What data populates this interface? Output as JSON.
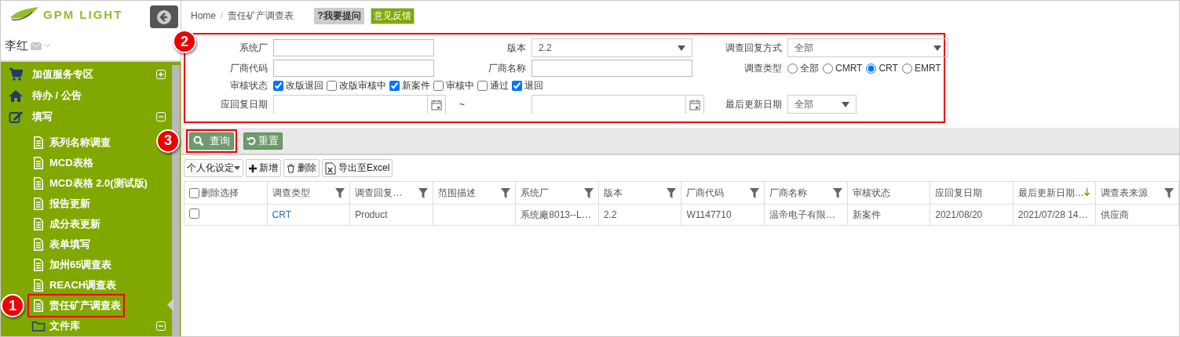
{
  "sidebar": {
    "logo": "GPM LIGHT",
    "user": "李红",
    "items": [
      {
        "label": "加值服务专区",
        "kind": "cart",
        "expanded": false
      },
      {
        "label": "待办 / 公告",
        "kind": "home"
      },
      {
        "label": "填写",
        "kind": "edit",
        "expanded": true,
        "children": [
          {
            "label": "系列名称调查",
            "kind": "doc",
            "highlighted": false
          },
          {
            "label": "MCD表格",
            "kind": "doc",
            "highlighted": false
          },
          {
            "label": "MCD表格 2.0(测试版)",
            "kind": "doc",
            "highlighted": false
          },
          {
            "label": "报告更新",
            "kind": "doc",
            "highlighted": false
          },
          {
            "label": "成分表更新",
            "kind": "doc",
            "highlighted": false
          },
          {
            "label": "表单填写",
            "kind": "doc",
            "highlighted": false
          },
          {
            "label": "加州65调查表",
            "kind": "doc",
            "highlighted": false
          },
          {
            "label": "REACH调查表",
            "kind": "doc",
            "highlighted": false
          },
          {
            "label": "责任矿产调查表",
            "kind": "doc",
            "highlighted": true,
            "callout": "1"
          },
          {
            "label": "文件库",
            "kind": "folder",
            "expanded": true,
            "highlighted": false
          }
        ]
      }
    ]
  },
  "breadcrumb": [
    "Home",
    "责任矿产调查表"
  ],
  "breadcrumb_separator": "/",
  "header_buttons": [
    {
      "label": "?我要提问",
      "kind": "help"
    },
    {
      "label": "意见反馈",
      "kind": "feedback"
    }
  ],
  "filter_panel": {
    "highlighted": true,
    "callout": "2",
    "rows": [
      [
        {
          "label": "系统厂",
          "kind": "text"
        },
        {
          "label": "版本",
          "kind": "select",
          "value": "2.2"
        },
        {
          "label": "调查回复方式",
          "kind": "select",
          "value": "全部"
        }
      ],
      [
        {
          "label": "厂商代码",
          "kind": "text"
        },
        {
          "label": "厂商名称",
          "kind": "text"
        },
        {
          "label": "调查类型",
          "kind": "radios",
          "options": [
            {
              "label": "全部",
              "selected": false
            },
            {
              "label": "CMRT",
              "selected": false
            },
            {
              "label": "CRT",
              "selected": true
            },
            {
              "label": "EMRT",
              "selected": false
            }
          ]
        }
      ],
      [
        {
          "label": "审核状态",
          "kind": "checkboxes",
          "options": [
            {
              "label": "改版退回",
              "checked": true
            },
            {
              "label": "改版审核中",
              "checked": false
            },
            {
              "label": "新案件",
              "checked": true
            },
            {
              "label": "审核中",
              "checked": false
            },
            {
              "label": "通过",
              "checked": false
            },
            {
              "label": "退回",
              "checked": true
            }
          ]
        }
      ],
      [
        {
          "label": "应回复日期",
          "kind": "date"
        },
        {
          "kind": "date_to",
          "separator": "~"
        },
        {
          "label": "最后更新日期",
          "kind": "select_small",
          "value": "全部"
        }
      ]
    ]
  },
  "search_buttons": [
    {
      "label": "查询",
      "kind": "search",
      "highlighted": true,
      "callout": "3"
    },
    {
      "label": "重置",
      "kind": "reset",
      "highlighted": false
    }
  ],
  "toolbar": [
    {
      "label": "个人化设定",
      "kind": "dropdown"
    },
    {
      "label": "新增",
      "kind": "add"
    },
    {
      "label": "删除",
      "kind": "delete"
    },
    {
      "label": "导出至Excel",
      "kind": "export"
    }
  ],
  "table": {
    "columns": [
      {
        "label": "删除选择",
        "kind": "select_all",
        "checked": false
      },
      {
        "label": "调查类型",
        "filter": true,
        "sorted": false
      },
      {
        "label": "调查回复…",
        "filter": true,
        "sorted": false
      },
      {
        "label": "范围描述",
        "filter": true,
        "sorted": false
      },
      {
        "label": "系统厂",
        "filter": true,
        "sorted": false
      },
      {
        "label": "版本",
        "filter": true,
        "sorted": false
      },
      {
        "label": "厂商代码",
        "filter": true,
        "sorted": false
      },
      {
        "label": "厂商名称",
        "filter": true,
        "sorted": false
      },
      {
        "label": "审核状态",
        "filter": false,
        "sorted": false
      },
      {
        "label": "应回复日期",
        "filter": false,
        "sorted": false
      },
      {
        "label": "最后更新日期…",
        "filter": false,
        "sorted": true
      },
      {
        "label": "调查表来源",
        "filter": true,
        "sorted": false
      }
    ],
    "rows": [
      {
        "cells": [
          {
            "kind": "checkbox",
            "checked": false
          },
          "CRT",
          "Product",
          "",
          "系统廠8013--L…",
          "2.2",
          "W1147710",
          "温帝电子有限…",
          "新案件",
          "2021/08/20",
          "2021/07/28 14…",
          "供应商"
        ]
      }
    ]
  }
}
